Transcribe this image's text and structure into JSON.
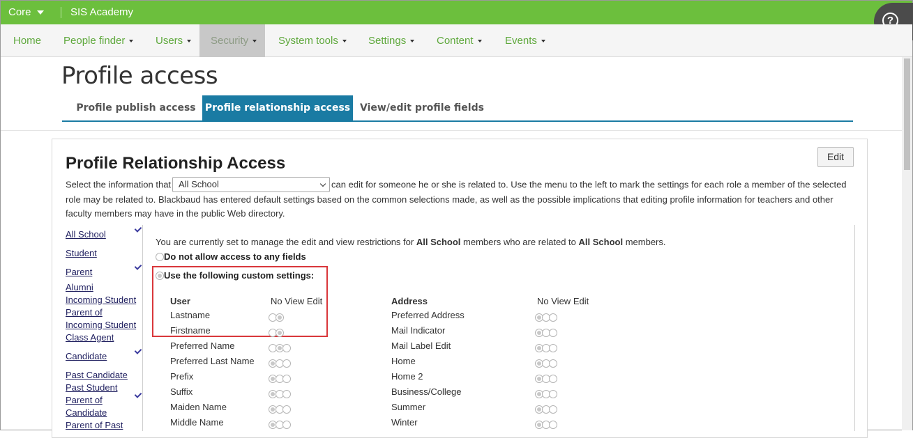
{
  "topbar": {
    "app": "Core",
    "school": "SIS Academy",
    "help_icon": "?"
  },
  "nav": {
    "items": [
      {
        "label": "Home",
        "dropdown": false,
        "active": false
      },
      {
        "label": "People finder",
        "dropdown": true,
        "active": false
      },
      {
        "label": "Users",
        "dropdown": true,
        "active": false
      },
      {
        "label": "Security",
        "dropdown": true,
        "active": true
      },
      {
        "label": "System tools",
        "dropdown": true,
        "active": false
      },
      {
        "label": "Settings",
        "dropdown": true,
        "active": false
      },
      {
        "label": "Content",
        "dropdown": true,
        "active": false
      },
      {
        "label": "Events",
        "dropdown": true,
        "active": false
      }
    ]
  },
  "page": {
    "title": "Profile access",
    "tabs": [
      {
        "label": "Profile publish access",
        "active": false
      },
      {
        "label": "Profile relationship access",
        "active": true
      },
      {
        "label": "View/edit profile fields",
        "active": false
      }
    ]
  },
  "section": {
    "title": "Profile Relationship Access",
    "edit_label": "Edit",
    "desc_before": "Select the information that",
    "select_value": "All School",
    "desc_after": "can edit for someone he or she is related to. Use the menu to the left to mark the settings for each role a member of the selected",
    "desc_rest": "role may be related to. Blackbaud has entered default settings based on the common selections made, as well as the possible implications that editing profile information for teachers and other faculty members may have in the public Web directory."
  },
  "roles": [
    {
      "label": "All School",
      "checked": true
    },
    {
      "label": "Student",
      "checked": false
    },
    {
      "label": "Parent",
      "checked": true
    },
    {
      "label": "Alumni",
      "checked": false
    },
    {
      "label": "Incoming Student",
      "checked": false
    },
    {
      "label": "Parent of",
      "checked": false
    },
    {
      "label": "Incoming Student",
      "checked": false
    },
    {
      "label": "Class Agent",
      "checked": false
    },
    {
      "label": "Candidate",
      "checked": true
    },
    {
      "label": "Past Candidate",
      "checked": false
    },
    {
      "label": "Past Student",
      "checked": false
    },
    {
      "label": "Parent of",
      "checked": true
    },
    {
      "label": "Candidate",
      "checked": false
    },
    {
      "label": "Parent of Past",
      "checked": false
    }
  ],
  "settings": {
    "info_prefix": "You are currently set to manage the edit and view restrictions for",
    "info_role1": "All School",
    "info_mid": "members who are related to",
    "info_role2": "All School",
    "info_suffix": "members.",
    "option_none": "Do not allow access to any fields",
    "option_custom": "Use the following custom settings:",
    "col_headers": {
      "no": "No",
      "view": "View",
      "edit": "Edit"
    },
    "groups": [
      {
        "title": "User",
        "fields": [
          {
            "label": "Lastname",
            "options": 2,
            "selected": 1
          },
          {
            "label": "Firstname",
            "options": 2,
            "selected": 1
          },
          {
            "label": "Preferred Name",
            "options": 3,
            "selected": 1
          },
          {
            "label": "Preferred Last Name",
            "options": 3,
            "selected": 0
          },
          {
            "label": "Prefix",
            "options": 3,
            "selected": 0
          },
          {
            "label": "Suffix",
            "options": 3,
            "selected": 0
          },
          {
            "label": "Maiden Name",
            "options": 3,
            "selected": 0
          },
          {
            "label": "Middle Name",
            "options": 3,
            "selected": 0
          }
        ]
      },
      {
        "title": "Address",
        "fields": [
          {
            "label": "Preferred Address",
            "options": 3,
            "selected": 0
          },
          {
            "label": "Mail Indicator",
            "options": 3,
            "selected": 0
          },
          {
            "label": "Mail Label Edit",
            "options": 3,
            "selected": 0
          },
          {
            "label": "Home",
            "options": 3,
            "selected": 0
          },
          {
            "label": "Home 2",
            "options": 3,
            "selected": 0
          },
          {
            "label": "Business/College",
            "options": 3,
            "selected": 0
          },
          {
            "label": "Summer",
            "options": 3,
            "selected": 0
          },
          {
            "label": "Winter",
            "options": 3,
            "selected": 0
          }
        ]
      }
    ]
  },
  "colors": {
    "brand_green": "#6cbf3d",
    "tab_blue": "#1a7ba3",
    "highlight_red": "#d9373b"
  }
}
